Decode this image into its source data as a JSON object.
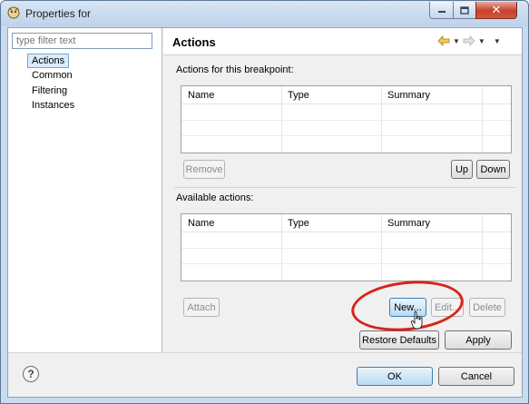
{
  "window": {
    "title": "Properties for",
    "controls": {
      "minimize_icon": "minimize-icon",
      "maximize_icon": "maximize-icon",
      "close_label": "✕"
    }
  },
  "filter": {
    "placeholder": "type filter text"
  },
  "nav": {
    "items": [
      {
        "label": "Actions",
        "selected": true
      },
      {
        "label": "Common"
      },
      {
        "label": "Filtering"
      },
      {
        "label": "Instances"
      }
    ]
  },
  "page": {
    "title": "Actions",
    "nav_icons": [
      "back-arrow-icon",
      "forward-arrow-icon"
    ]
  },
  "breakpoint_actions": {
    "label": "Actions for this breakpoint:",
    "columns": [
      "Name",
      "Type",
      "Summary"
    ],
    "rows": [],
    "buttons": {
      "remove": "Remove",
      "up": "Up",
      "down": "Down"
    }
  },
  "available_actions": {
    "label": "Available actions:",
    "columns": [
      "Name",
      "Type",
      "Summary"
    ],
    "rows": [],
    "buttons": {
      "attach": "Attach",
      "new": "New...",
      "edit": "Edit...",
      "delete": "Delete"
    }
  },
  "page_buttons": {
    "restore_defaults": "Restore Defaults",
    "apply": "Apply"
  },
  "dialog_buttons": {
    "ok": "OK",
    "cancel": "Cancel",
    "help": "?"
  },
  "colors": {
    "highlight": "#d8231a",
    "selection": "#dcebfc",
    "window_frame": "#c9dbef"
  }
}
